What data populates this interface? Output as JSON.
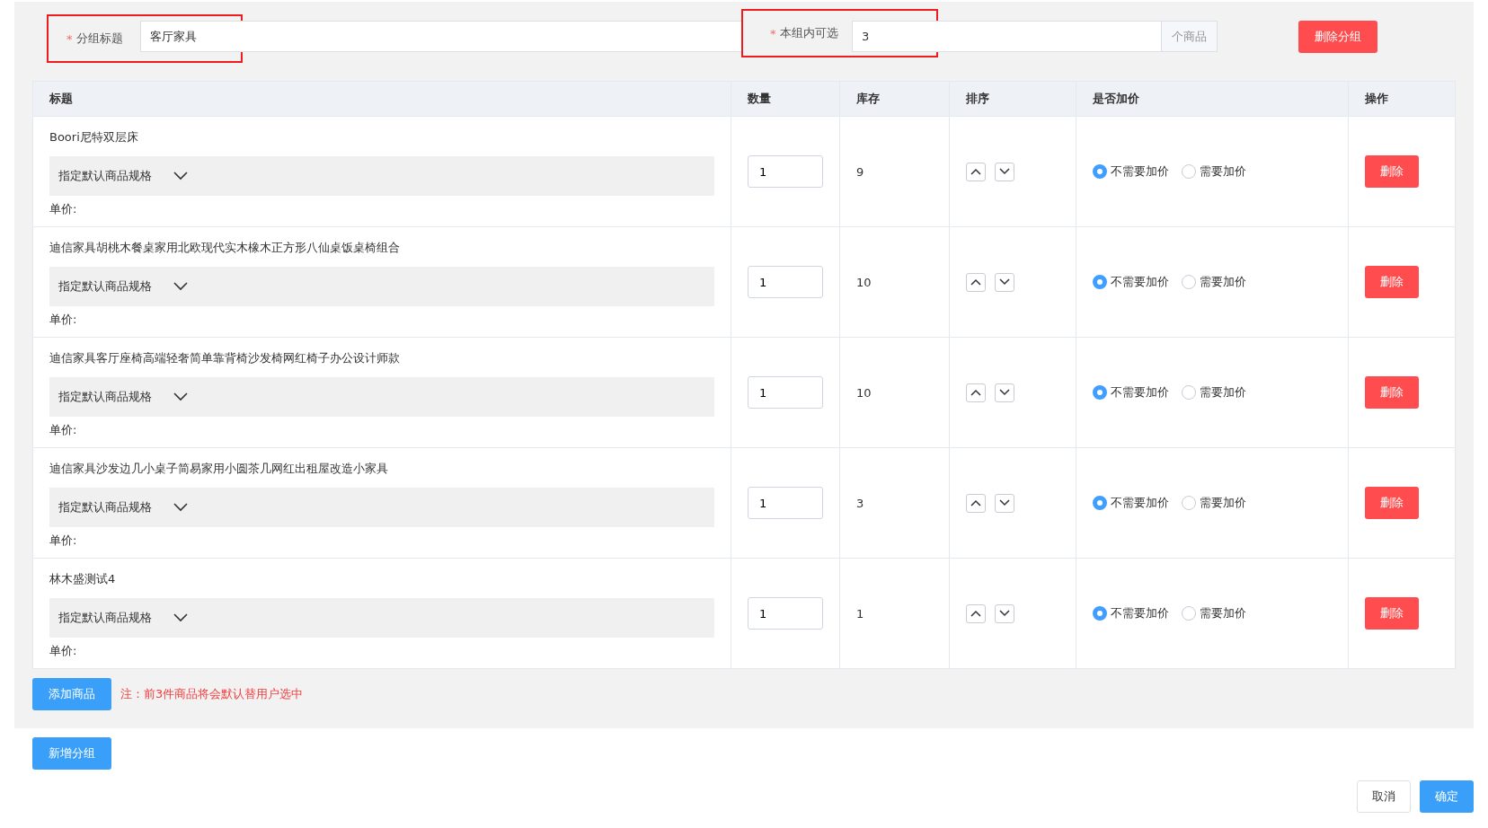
{
  "group_title": {
    "required_mark": "*",
    "label": "分组标题",
    "value": "客厅家具",
    "highlighted": true
  },
  "selectable": {
    "required_mark": "*",
    "label": "本组内可选",
    "value": "3",
    "suffix": "个商品",
    "highlighted": true
  },
  "delete_group_button": "删除分组",
  "table": {
    "columns": [
      "标题",
      "数量",
      "库存",
      "排序",
      "是否加价",
      "操作"
    ],
    "rows": [
      {
        "title": "Boori尼特双层床",
        "spec": "指定默认商品规格",
        "unit_price": "单价:",
        "quantity": "1",
        "stock": "9",
        "markup": [
          {
            "label": "不需要加价",
            "selected": true
          },
          {
            "label": "需要加价",
            "selected": false
          }
        ],
        "delete": "删除"
      },
      {
        "title": "迪信家具胡桃木餐桌家用北欧现代实木橡木正方形八仙桌饭桌椅组合",
        "spec": "指定默认商品规格",
        "unit_price": "单价:",
        "quantity": "1",
        "stock": "10",
        "markup": [
          {
            "label": "不需要加价",
            "selected": true
          },
          {
            "label": "需要加价",
            "selected": false
          }
        ],
        "delete": "删除"
      },
      {
        "title": "迪信家具客厅座椅高端轻奢简单靠背椅沙发椅网红椅子办公设计师款",
        "spec": "指定默认商品规格",
        "unit_price": "单价:",
        "quantity": "1",
        "stock": "10",
        "markup": [
          {
            "label": "不需要加价",
            "selected": true
          },
          {
            "label": "需要加价",
            "selected": false
          }
        ],
        "delete": "删除"
      },
      {
        "title": "迪信家具沙发边几小桌子简易家用小圆茶几网红出租屋改造小家具",
        "spec": "指定默认商品规格",
        "unit_price": "单价:",
        "quantity": "1",
        "stock": "3",
        "markup": [
          {
            "label": "不需要加价",
            "selected": true
          },
          {
            "label": "需要加价",
            "selected": false
          }
        ],
        "delete": "删除"
      },
      {
        "title": "林木盛测试4",
        "spec": "指定默认商品规格",
        "unit_price": "单价:",
        "quantity": "1",
        "stock": "1",
        "markup": [
          {
            "label": "不需要加价",
            "selected": true
          },
          {
            "label": "需要加价",
            "selected": false
          }
        ],
        "delete": "删除"
      }
    ]
  },
  "add_product_button": "添加商品",
  "note": "注：前3件商品将会默认替用户选中",
  "new_group_button": "新增分组",
  "cancel_button": "取消",
  "confirm_button": "确定"
}
